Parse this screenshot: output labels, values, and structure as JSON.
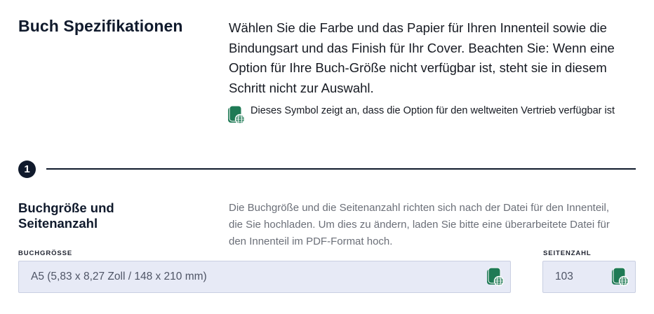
{
  "header": {
    "title": "Buch Spezifikationen",
    "intro": "Wählen Sie die Farbe und das Papier für Ihren Innenteil sowie die Bindungsart und das Finish für Ihr Cover. Beachten Sie: Wenn eine Option für Ihre Buch-Größe nicht verfügbar ist, steht sie in diesem Schritt nicht zur Auswahl.",
    "legend_text": "Dieses Symbol zeigt an, dass die Option für den weltweiten Vertrieb verfügbar ist",
    "legend_icon": "global-distribution-icon"
  },
  "step": {
    "number": "1"
  },
  "section": {
    "title": "Buchgröße und Seitenanzahl",
    "description": "Die Buchgröße und die Seitenanzahl richten sich nach der Datei für den Innenteil, die Sie hochladen. Um dies zu ändern, laden Sie bitte eine überarbeitete Datei für den Innenteil im PDF-Format hoch.",
    "book_size": {
      "label": "BUCHGRÖSSE",
      "value": "A5 (5,83 x 8,27 Zoll / 148 x 210 mm)",
      "icon": "global-distribution-icon"
    },
    "page_count": {
      "label": "SEITENZAHL",
      "value": "103",
      "icon": "global-distribution-icon"
    }
  },
  "colors": {
    "navy": "#101a2c",
    "icon_green": "#1f7a55",
    "field_bg": "#e7eaf6",
    "field_border": "#c9cfe2"
  }
}
